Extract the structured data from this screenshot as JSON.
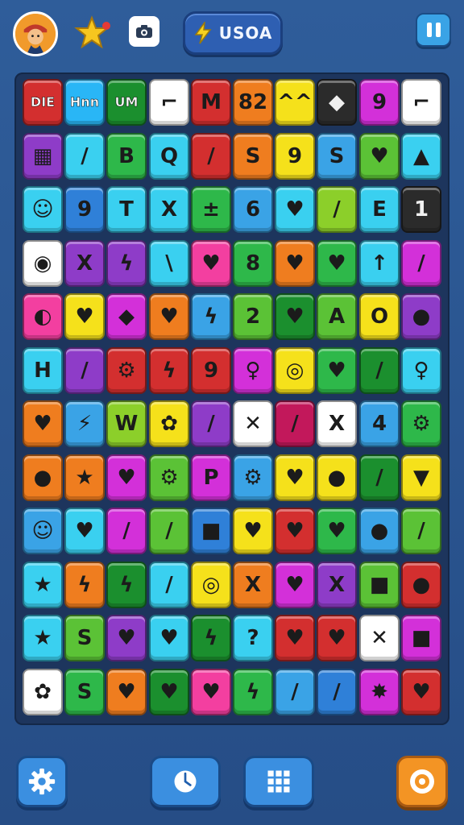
{
  "header": {
    "score_text": "USOA",
    "icons": [
      "avatar-icon",
      "star-icon",
      "camera-icon",
      "bolt-icon",
      "pause-icon"
    ],
    "star_badge_color": "#e53935"
  },
  "board": {
    "rows": [
      [
        {
          "c": "#d32f2f",
          "t": "DIE",
          "s": 1
        },
        {
          "c": "#29b6f6",
          "t": "Hnn",
          "s": 1
        },
        {
          "c": "#1b8f2e",
          "t": "UM",
          "s": 1
        },
        {
          "c": "#ffffff",
          "t": "⌐",
          "s": 0
        },
        {
          "c": "#d32f2f",
          "t": "M",
          "s": 0
        },
        {
          "c": "#ef7d1f",
          "t": "82",
          "s": 0
        },
        {
          "c": "#f5e11b",
          "t": "^^",
          "s": 0
        },
        {
          "c": "#2b2b2b",
          "t": "◆",
          "s": 0
        },
        {
          "c": "#d330d9",
          "t": "9",
          "s": 0
        },
        {
          "c": "#ffffff",
          "t": "⌐",
          "s": 0
        }
      ],
      [
        {
          "c": "#8e3cc8",
          "t": "▦",
          "s": 0
        },
        {
          "c": "#3ad0f0",
          "t": "/",
          "s": 0
        },
        {
          "c": "#2eb84a",
          "t": "B",
          "s": 0
        },
        {
          "c": "#3ad0f0",
          "t": "Q",
          "s": 0
        },
        {
          "c": "#d32f2f",
          "t": "/",
          "s": 0
        },
        {
          "c": "#ef7d1f",
          "t": "S",
          "s": 0
        },
        {
          "c": "#f5e11b",
          "t": "9",
          "s": 0
        },
        {
          "c": "#3aa3e6",
          "t": "S",
          "s": 0
        },
        {
          "c": "#5bc236",
          "t": "♥",
          "s": 0
        },
        {
          "c": "#3ad0f0",
          "t": "▲",
          "s": 0
        }
      ],
      [
        {
          "c": "#3ad0f0",
          "t": "☺",
          "s": 0
        },
        {
          "c": "#2f80d8",
          "t": "9",
          "s": 0
        },
        {
          "c": "#3ad0f0",
          "t": "T",
          "s": 0
        },
        {
          "c": "#3ad0f0",
          "t": "X",
          "s": 0
        },
        {
          "c": "#2eb84a",
          "t": "±",
          "s": 0
        },
        {
          "c": "#3aa3e6",
          "t": "6",
          "s": 0
        },
        {
          "c": "#3ad0f0",
          "t": "♥",
          "s": 0
        },
        {
          "c": "#8ccf2a",
          "t": "/",
          "s": 0
        },
        {
          "c": "#3ad0f0",
          "t": "E",
          "s": 0
        },
        {
          "c": "#2b2b2b",
          "t": "1",
          "s": 0
        }
      ],
      [
        {
          "c": "#ffffff",
          "t": "◉",
          "s": 0
        },
        {
          "c": "#8e3cc8",
          "t": "X",
          "s": 0
        },
        {
          "c": "#8e3cc8",
          "t": "ϟ",
          "s": 0
        },
        {
          "c": "#3ad0f0",
          "t": "\\",
          "s": 0
        },
        {
          "c": "#f33fa0",
          "t": "♥",
          "s": 0
        },
        {
          "c": "#2eb84a",
          "t": "8",
          "s": 0
        },
        {
          "c": "#ef7d1f",
          "t": "♥",
          "s": 0
        },
        {
          "c": "#2eb84a",
          "t": "♥",
          "s": 0
        },
        {
          "c": "#3ad0f0",
          "t": "↑",
          "s": 0
        },
        {
          "c": "#d330d9",
          "t": "/",
          "s": 0
        }
      ],
      [
        {
          "c": "#f33fa0",
          "t": "◐",
          "s": 0
        },
        {
          "c": "#f5e11b",
          "t": "♥",
          "s": 0
        },
        {
          "c": "#d330d9",
          "t": "◆",
          "s": 0
        },
        {
          "c": "#ef7d1f",
          "t": "♥",
          "s": 0
        },
        {
          "c": "#3aa3e6",
          "t": "ϟ",
          "s": 0
        },
        {
          "c": "#5bc236",
          "t": "2",
          "s": 0
        },
        {
          "c": "#1b8f2e",
          "t": "♥",
          "s": 0
        },
        {
          "c": "#5bc236",
          "t": "A",
          "s": 0
        },
        {
          "c": "#f5e11b",
          "t": "O",
          "s": 0
        },
        {
          "c": "#8e3cc8",
          "t": "●",
          "s": 0
        }
      ],
      [
        {
          "c": "#3ad0f0",
          "t": "H",
          "s": 0
        },
        {
          "c": "#8e3cc8",
          "t": "/",
          "s": 0
        },
        {
          "c": "#d32f2f",
          "t": "⚙",
          "s": 0
        },
        {
          "c": "#d32f2f",
          "t": "ϟ",
          "s": 0
        },
        {
          "c": "#d32f2f",
          "t": "9",
          "s": 0
        },
        {
          "c": "#d330d9",
          "t": "♀",
          "s": 0
        },
        {
          "c": "#f5e11b",
          "t": "◎",
          "s": 0
        },
        {
          "c": "#2eb84a",
          "t": "♥",
          "s": 0
        },
        {
          "c": "#1b8f2e",
          "t": "/",
          "s": 0
        },
        {
          "c": "#3ad0f0",
          "t": "♀",
          "s": 0
        }
      ],
      [
        {
          "c": "#ef7d1f",
          "t": "♥",
          "s": 0
        },
        {
          "c": "#3aa3e6",
          "t": "⚡",
          "s": 0
        },
        {
          "c": "#8ccf2a",
          "t": "W",
          "s": 0
        },
        {
          "c": "#f5e11b",
          "t": "✿",
          "s": 0
        },
        {
          "c": "#8e3cc8",
          "t": "/",
          "s": 0
        },
        {
          "c": "#ffffff",
          "t": "✕",
          "s": 0
        },
        {
          "c": "#c2185b",
          "t": "/",
          "s": 0
        },
        {
          "c": "#ffffff",
          "t": "X",
          "s": 0
        },
        {
          "c": "#3aa3e6",
          "t": "4",
          "s": 0
        },
        {
          "c": "#2eb84a",
          "t": "⚙",
          "s": 0
        }
      ],
      [
        {
          "c": "#ef7d1f",
          "t": "●",
          "s": 0
        },
        {
          "c": "#ef7d1f",
          "t": "★",
          "s": 0
        },
        {
          "c": "#d330d9",
          "t": "♥",
          "s": 0
        },
        {
          "c": "#5bc236",
          "t": "⚙",
          "s": 0
        },
        {
          "c": "#d330d9",
          "t": "P",
          "s": 0
        },
        {
          "c": "#3aa3e6",
          "t": "⚙",
          "s": 0
        },
        {
          "c": "#f5e11b",
          "t": "♥",
          "s": 0
        },
        {
          "c": "#f5e11b",
          "t": "●",
          "s": 0
        },
        {
          "c": "#1b8f2e",
          "t": "/",
          "s": 0
        },
        {
          "c": "#f5e11b",
          "t": "▼",
          "s": 0
        }
      ],
      [
        {
          "c": "#3aa3e6",
          "t": "☺",
          "s": 0
        },
        {
          "c": "#3ad0f0",
          "t": "♥",
          "s": 0
        },
        {
          "c": "#d330d9",
          "t": "/",
          "s": 0
        },
        {
          "c": "#5bc236",
          "t": "/",
          "s": 0
        },
        {
          "c": "#2f80d8",
          "t": "■",
          "s": 0
        },
        {
          "c": "#f5e11b",
          "t": "♥",
          "s": 0
        },
        {
          "c": "#d32f2f",
          "t": "♥",
          "s": 0
        },
        {
          "c": "#2eb84a",
          "t": "♥",
          "s": 0
        },
        {
          "c": "#3aa3e6",
          "t": "●",
          "s": 0
        },
        {
          "c": "#5bc236",
          "t": "/",
          "s": 0
        }
      ],
      [
        {
          "c": "#3ad0f0",
          "t": "★",
          "s": 0
        },
        {
          "c": "#ef7d1f",
          "t": "ϟ",
          "s": 0
        },
        {
          "c": "#1b8f2e",
          "t": "ϟ",
          "s": 0
        },
        {
          "c": "#3ad0f0",
          "t": "/",
          "s": 0
        },
        {
          "c": "#f5e11b",
          "t": "◎",
          "s": 0
        },
        {
          "c": "#ef7d1f",
          "t": "X",
          "s": 0
        },
        {
          "c": "#d330d9",
          "t": "♥",
          "s": 0
        },
        {
          "c": "#8e3cc8",
          "t": "X",
          "s": 0
        },
        {
          "c": "#5bc236",
          "t": "■",
          "s": 0
        },
        {
          "c": "#d32f2f",
          "t": "●",
          "s": 0
        }
      ],
      [
        {
          "c": "#3ad0f0",
          "t": "★",
          "s": 0
        },
        {
          "c": "#5bc236",
          "t": "S",
          "s": 0
        },
        {
          "c": "#8e3cc8",
          "t": "♥",
          "s": 0
        },
        {
          "c": "#3ad0f0",
          "t": "♥",
          "s": 0
        },
        {
          "c": "#1b8f2e",
          "t": "ϟ",
          "s": 0
        },
        {
          "c": "#3ad0f0",
          "t": "?",
          "s": 0
        },
        {
          "c": "#d32f2f",
          "t": "♥",
          "s": 0
        },
        {
          "c": "#d32f2f",
          "t": "♥",
          "s": 0
        },
        {
          "c": "#ffffff",
          "t": "✕",
          "s": 0
        },
        {
          "c": "#d330d9",
          "t": "■",
          "s": 0
        }
      ],
      [
        {
          "c": "#ffffff",
          "t": "✿",
          "s": 0
        },
        {
          "c": "#2eb84a",
          "t": "S",
          "s": 0
        },
        {
          "c": "#ef7d1f",
          "t": "♥",
          "s": 0
        },
        {
          "c": "#1b8f2e",
          "t": "♥",
          "s": 0
        },
        {
          "c": "#f33fa0",
          "t": "♥",
          "s": 0
        },
        {
          "c": "#2eb84a",
          "t": "ϟ",
          "s": 0
        },
        {
          "c": "#3aa3e6",
          "t": "/",
          "s": 0
        },
        {
          "c": "#2f80d8",
          "t": "/",
          "s": 0
        },
        {
          "c": "#d330d9",
          "t": "✸",
          "s": 0
        },
        {
          "c": "#d32f2f",
          "t": "♥",
          "s": 0
        }
      ]
    ]
  },
  "footer": {
    "buttons": [
      "settings-gear-icon",
      "hint-clock-icon",
      "grid-icon",
      "target-icon"
    ]
  }
}
